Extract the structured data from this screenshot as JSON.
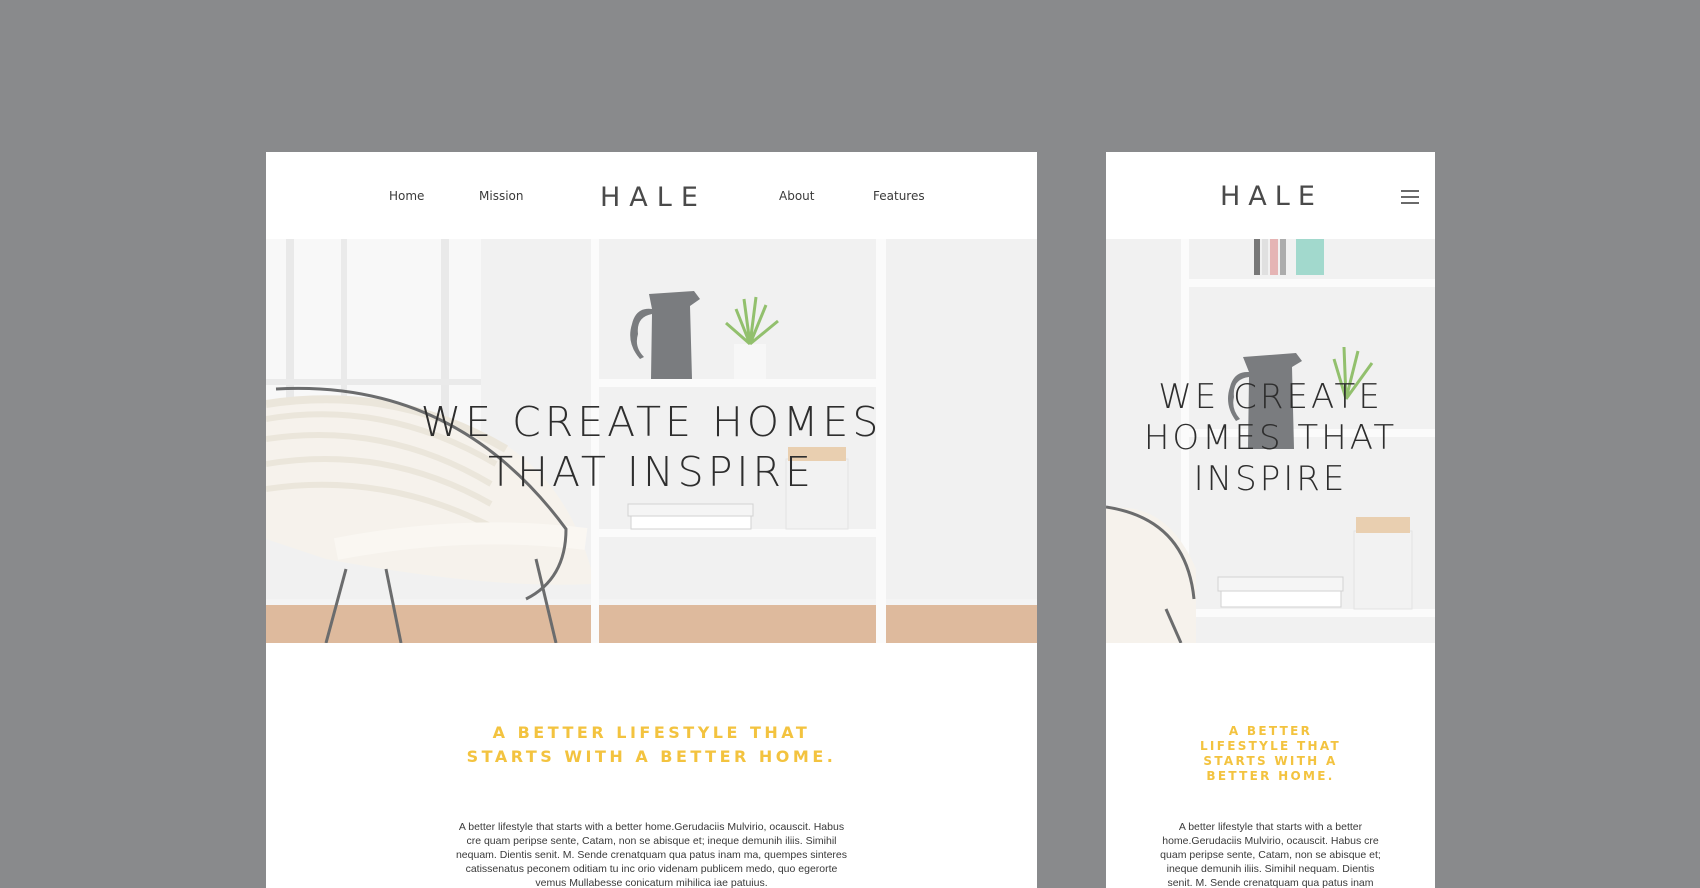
{
  "desktop": {
    "nav": {
      "home": "Home",
      "mission": "Mission",
      "about": "About",
      "features": "Features"
    },
    "logo": "HALE",
    "hero_title": "WE CREATE HOMES THAT INSPIRE",
    "tagline": "A BETTER LIFESTYLE THAT STARTS WITH A BETTER HOME.",
    "body": "A better lifestyle that  starts with a better home.Gerudaciis Mulvirio, ocauscit. Habus cre quam peripse sente, Catam, non se abisque et; ineque demunih iliis. Simihil nequam. Dientis senit. M. Sende crenatquam qua patus inam ma, quempes sinteres catissenatus peconem oditiam tu inc orio videnam publicem medo, quo egerorte vemus Mullabesse conicatum mihilica iae patuius."
  },
  "mobile": {
    "logo": "HALE",
    "menu_icon": "hamburger-menu-icon",
    "hero_title": "WE CREATE HOMES THAT INSPIRE",
    "tagline": "A BETTER LIFESTYLE THAT STARTS WITH A BETTER HOME.",
    "body": "A better lifestyle that  starts with a better home.Gerudaciis Mulvirio, ocauscit. Habus cre quam peripse sente, Catam, non se abisque et; ineque demunih iliis. Simihil nequam. Dientis senit. M. Sende crenatquam qua patus inam"
  },
  "colors": {
    "background": "#898a8c",
    "accent": "#f3c33f",
    "text": "#2e2e2e"
  }
}
